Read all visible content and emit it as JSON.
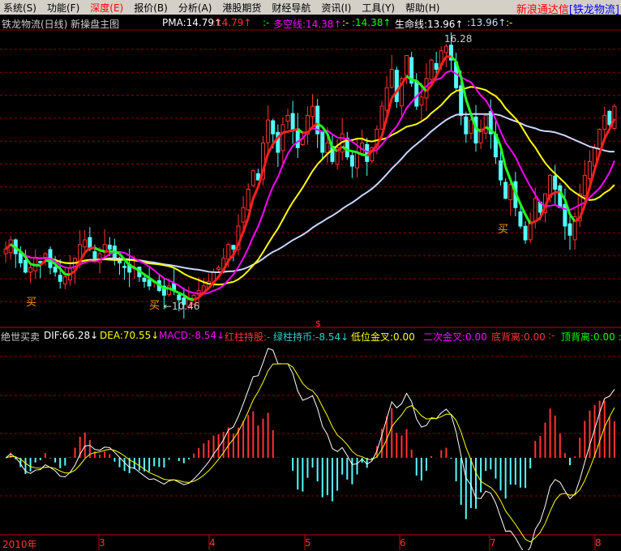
{
  "menu": [
    "系统(S)",
    "功能(F)",
    "深度(E)",
    "报价(B)",
    "分析(A)",
    "港股期货",
    "财经导航",
    "资讯(I)",
    "工具(Y)",
    "帮助(H)"
  ],
  "brand": {
    "name": "新浪通达信",
    "stock": "[铁龙物流]"
  },
  "title": "铁龙物流(日线) 新操盘主图",
  "indicators": {
    "pma": "PMA:14.79↑",
    "pma2": ":14.79↑",
    "sep1": ":-",
    "dkx": "多空线:14.38↑",
    "sep2": ":-",
    "dkx2": ":14.38↑",
    "life": "生命线:13.96↑",
    "life2": ":13.96↑",
    "sep3": ":-"
  },
  "annotations": {
    "buy": "买",
    "low": "←10.46",
    "high": "16.28",
    "marker": "$"
  },
  "macd": {
    "name": "绝世买卖",
    "dif": "DIF:66.28↓",
    "dea": "DEA:70.55↓",
    "macd": "MACD:-8.54↓",
    "red": "红柱持股:-",
    "green": "绿柱持币:-8.54↓",
    "low_cross": "低位金叉:0.00",
    "second_cross": "二次金叉:0.00",
    "bottom_div": "底背离:0.00",
    "sep": ":-",
    "top_div": "顶背离:0.00 :"
  },
  "xaxis": [
    "2010年",
    "3",
    "4",
    "5",
    "6",
    "7",
    "8"
  ],
  "colors": {
    "up": "#ff3232",
    "down": "#54fcfc",
    "grid": "#8b0000"
  },
  "chart_data": {
    "type": "candlestick",
    "price_range": [
      10.46,
      16.28
    ],
    "closes": [
      11.7,
      11.9,
      11.6,
      11.4,
      11.2,
      11.3,
      11.5,
      11.4,
      11.6,
      11.3,
      11.2,
      11.0,
      11.1,
      11.3,
      11.5,
      11.8,
      11.9,
      11.7,
      11.5,
      11.6,
      11.8,
      11.7,
      11.5,
      11.4,
      11.3,
      11.2,
      11.3,
      11.1,
      11.0,
      10.9,
      11.0,
      10.8,
      10.7,
      10.9,
      10.8,
      10.6,
      10.5,
      10.6,
      10.7,
      10.8,
      10.9,
      11.0,
      11.2,
      11.3,
      11.5,
      11.8,
      11.7,
      12.2,
      12.6,
      13.0,
      13.4,
      13.2,
      14.0,
      14.5,
      14.2,
      13.8,
      14.4,
      14.6,
      14.3,
      13.9,
      14.1,
      14.6,
      14.8,
      14.2,
      13.8,
      14.0,
      13.6,
      13.9,
      14.2,
      13.7,
      13.5,
      13.8,
      14.0,
      13.6,
      13.9,
      14.3,
      14.8,
      15.2,
      15.6,
      14.9,
      15.4,
      15.9,
      15.3,
      14.8,
      15.0,
      15.4,
      15.8,
      15.6,
      16.0,
      16.1,
      15.8,
      15.2,
      14.6,
      14.2,
      14.5,
      14.0,
      14.3,
      14.6,
      14.2,
      13.7,
      13.2,
      12.8,
      13.1,
      12.6,
      12.2,
      11.9,
      12.3,
      12.8,
      12.5,
      12.9,
      13.3,
      13.0,
      12.6,
      12.2,
      12.0,
      12.4,
      12.9,
      13.3,
      13.6,
      13.9,
      14.3,
      14.6,
      14.4,
      14.8
    ]
  }
}
